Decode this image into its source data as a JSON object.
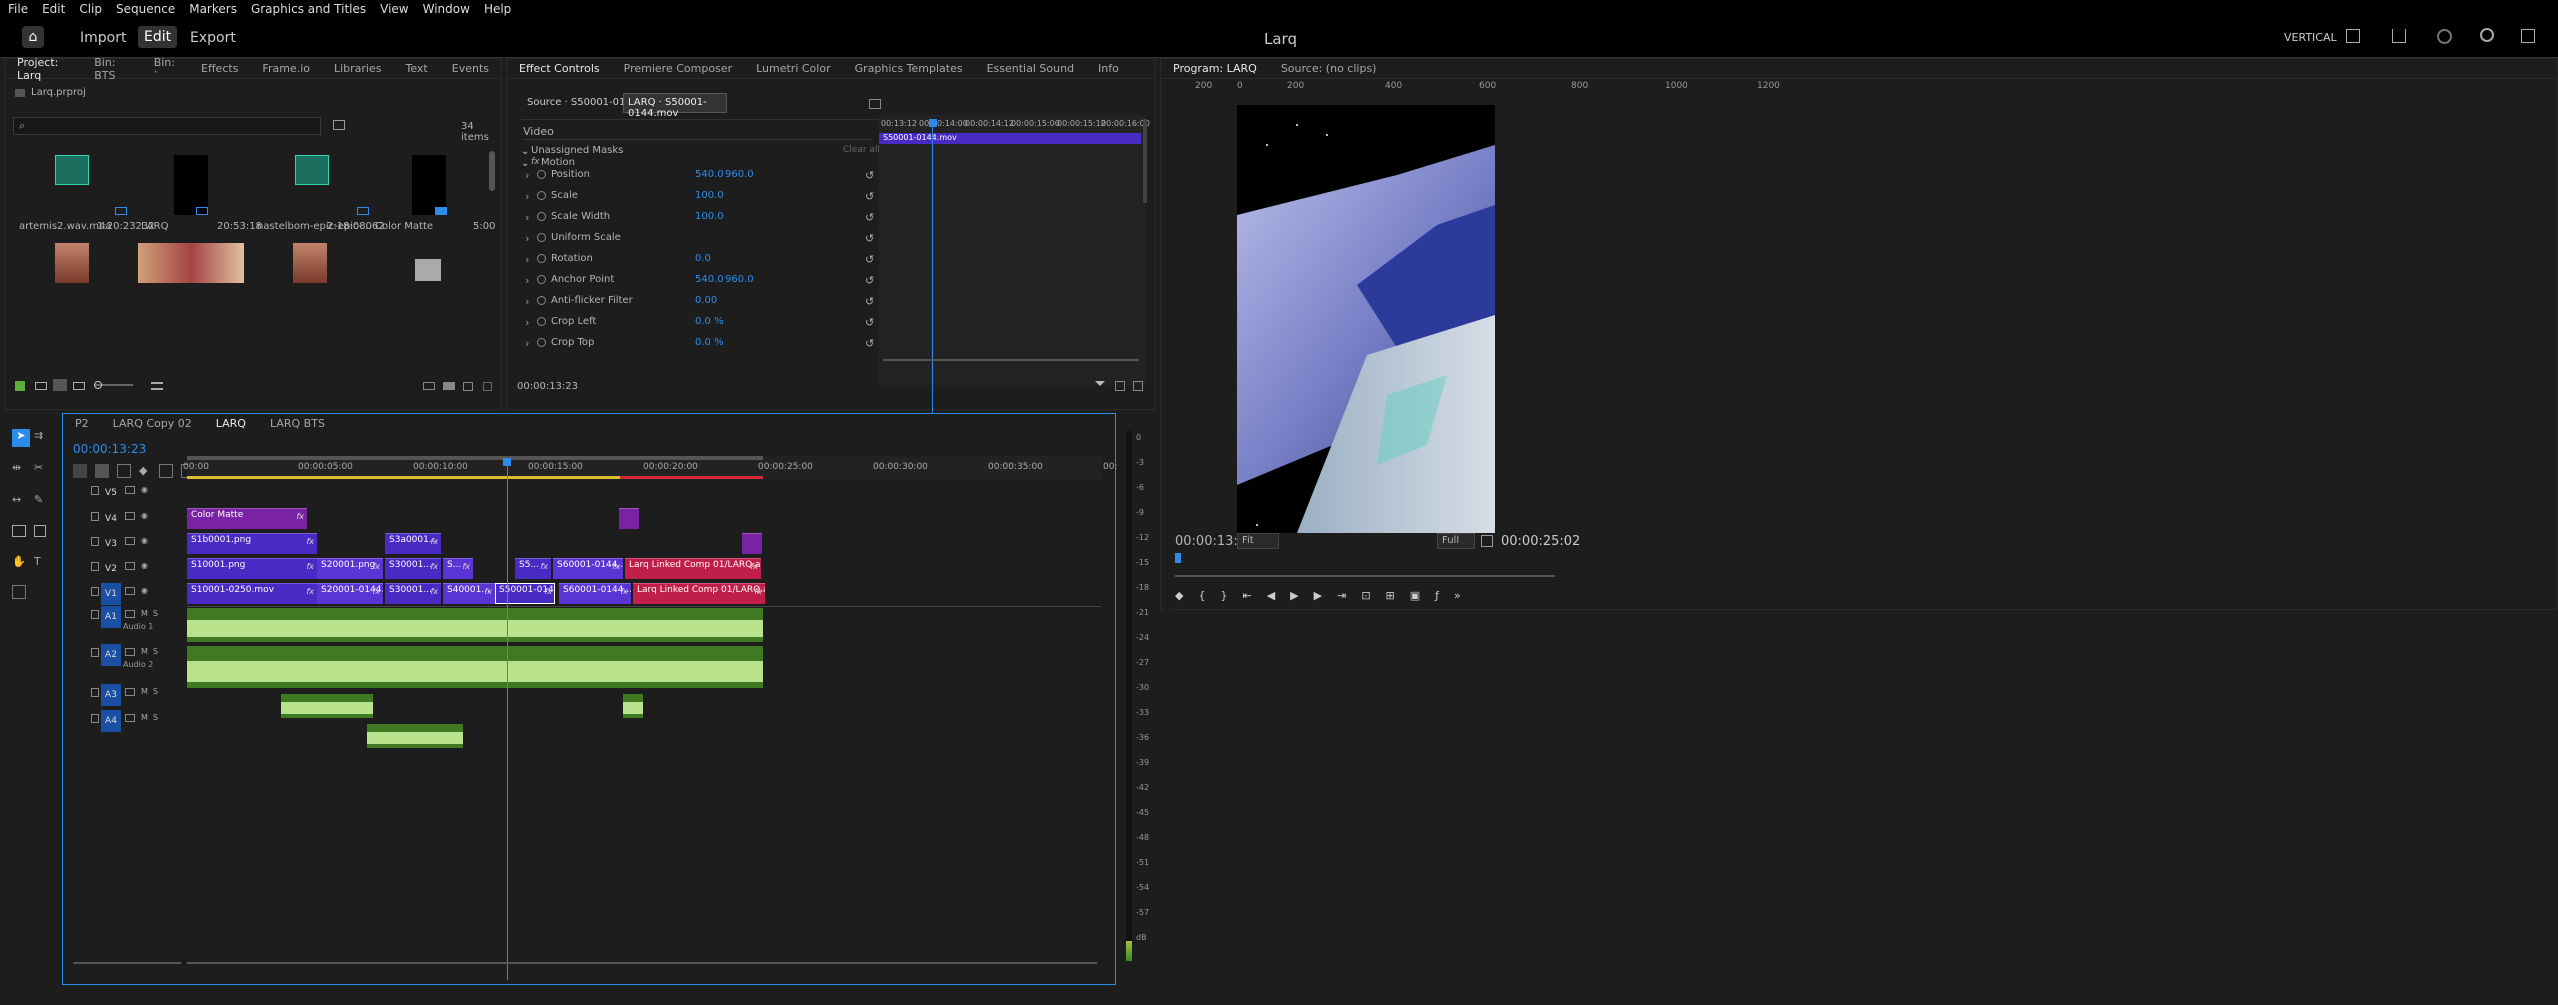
{
  "menu": [
    "File",
    "Edit",
    "Clip",
    "Sequence",
    "Markers",
    "Graphics and Titles",
    "View",
    "Window",
    "Help"
  ],
  "workspace": {
    "tabs": [
      "Import",
      "Edit",
      "Export"
    ],
    "active": "Edit",
    "title": "Larq",
    "mode": "VERTICAL"
  },
  "project": {
    "tabs": [
      "Project: Larq",
      "Bin: BTS",
      "Bin: `",
      "Effects",
      "Frame.io",
      "Libraries",
      "Text",
      "Events"
    ],
    "file": "Larq.prproj",
    "count": "34 items",
    "items": [
      {
        "name": "artemis2.wav.m4a",
        "dur": "1:20:23232"
      },
      {
        "name": "LARQ",
        "dur": "20:53:18"
      },
      {
        "name": "nastelbom-epic-epic-...",
        "dur": "2:18:08062"
      },
      {
        "name": "Color Matte",
        "dur": "5:00"
      }
    ]
  },
  "effects": {
    "tabs": [
      "Effect Controls",
      "Premiere Composer",
      "Lumetri Color",
      "Graphics Templates",
      "Essential Sound",
      "Info"
    ],
    "source": "Source · S50001-0144.mov",
    "seq": "LARQ · S50001-0144.mov",
    "section": "Video",
    "masks": "Unassigned Masks",
    "clear": "Clear all",
    "motion": "Motion",
    "props": [
      {
        "name": "Position",
        "v1": "540.0",
        "v2": "960.0"
      },
      {
        "name": "Scale",
        "v1": "100.0",
        "v2": ""
      },
      {
        "name": "Scale Width",
        "v1": "100.0",
        "v2": ""
      },
      {
        "name": "Uniform Scale",
        "v1": "",
        "v2": ""
      },
      {
        "name": "Rotation",
        "v1": "0.0",
        "v2": ""
      },
      {
        "name": "Anchor Point",
        "v1": "540.0",
        "v2": "960.0"
      },
      {
        "name": "Anti-flicker Filter",
        "v1": "0.00",
        "v2": ""
      },
      {
        "name": "Crop Left",
        "v1": "0.0 %",
        "v2": ""
      },
      {
        "name": "Crop Top",
        "v1": "0.0 %",
        "v2": ""
      }
    ],
    "ruler": [
      "00:13:12",
      "00:00:14:00",
      "00:00:14:12",
      "00:00:15:00",
      "00:00:15:12",
      "00:00:16:00"
    ],
    "clipname": "S50001-0144.mov",
    "timecode": "00:00:13:23"
  },
  "program": {
    "tab": "Program: LARQ",
    "source": "Source: (no clips)",
    "ruler": [
      "200",
      "0",
      "200",
      "400",
      "600",
      "800",
      "1000",
      "1200"
    ],
    "timecode": "00:00:13:23",
    "fit": "Fit",
    "quality": "Full",
    "duration": "00:00:25:02"
  },
  "timeline": {
    "tabs": [
      "P2",
      "LARQ Copy 02",
      "LARQ",
      "LARQ BTS"
    ],
    "timecode": "00:00:13:23",
    "ruler": [
      "00:00",
      "00:00:05:00",
      "00:00:10:00",
      "00:00:15:00",
      "00:00:20:00",
      "00:00:25:00",
      "00:00:30:00",
      "00:00:35:00",
      "00:0"
    ],
    "tracks": [
      "V5",
      "V4",
      "V3",
      "V2",
      "V1",
      "A1",
      "A2",
      "A3",
      "A4"
    ],
    "audioNames": {
      "A1": "Audio 1",
      "A2": "Audio 2"
    },
    "clips": {
      "colormatte": "Color Matte",
      "v3a": "S1b0001.png",
      "v3b": "S3a0001...",
      "v2a": "S10001.png",
      "v2b": "S20001.png",
      "v2c": "S30001...",
      "v2d": "S...",
      "v2e": "S5...",
      "v2f": "S60001-0144...",
      "v2g": "Larq Linked Comp 01/LARQ.aep",
      "v1a": "S10001-0250.mov",
      "v1b": "S20001-0144...",
      "v1c": "S30001...",
      "v1d": "S40001...",
      "v1e": "S50001-0144...",
      "v1f": "S60001-0144...",
      "v1g": "Larq Linked Comp 01/LARQ.aep"
    }
  },
  "meter": [
    "0",
    "-3",
    "-6",
    "-9",
    "-12",
    "-15",
    "-18",
    "-21",
    "-24",
    "-27",
    "-30",
    "-33",
    "-36",
    "-39",
    "-42",
    "-45",
    "-48",
    "-51",
    "-54",
    "-57",
    "dB"
  ],
  "colors": {
    "accent": "#2d8ceb",
    "video": "#4a2ac4",
    "audio": "#3f7a22",
    "pink": "#c01f4a",
    "purple": "#7a22a4"
  }
}
